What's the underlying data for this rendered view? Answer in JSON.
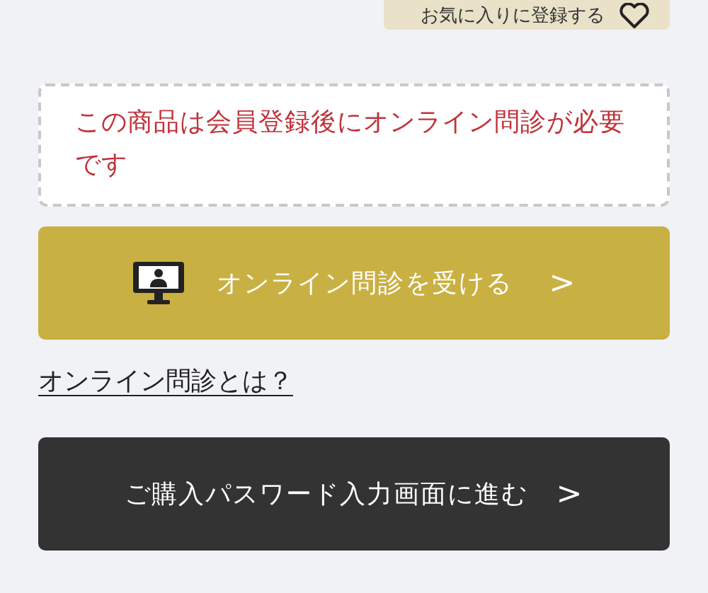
{
  "favorite_button": {
    "label": "お気に入りに登録する"
  },
  "notice": {
    "text": "この商品は会員登録後にオンライン問診が必要です"
  },
  "consult_button": {
    "label": "オンライン問診を受ける",
    "chevron": ">"
  },
  "about_link": {
    "label": "オンライン問診とは？"
  },
  "password_button": {
    "label": "ご購入パスワード入力画面に進む",
    "chevron": ">"
  }
}
